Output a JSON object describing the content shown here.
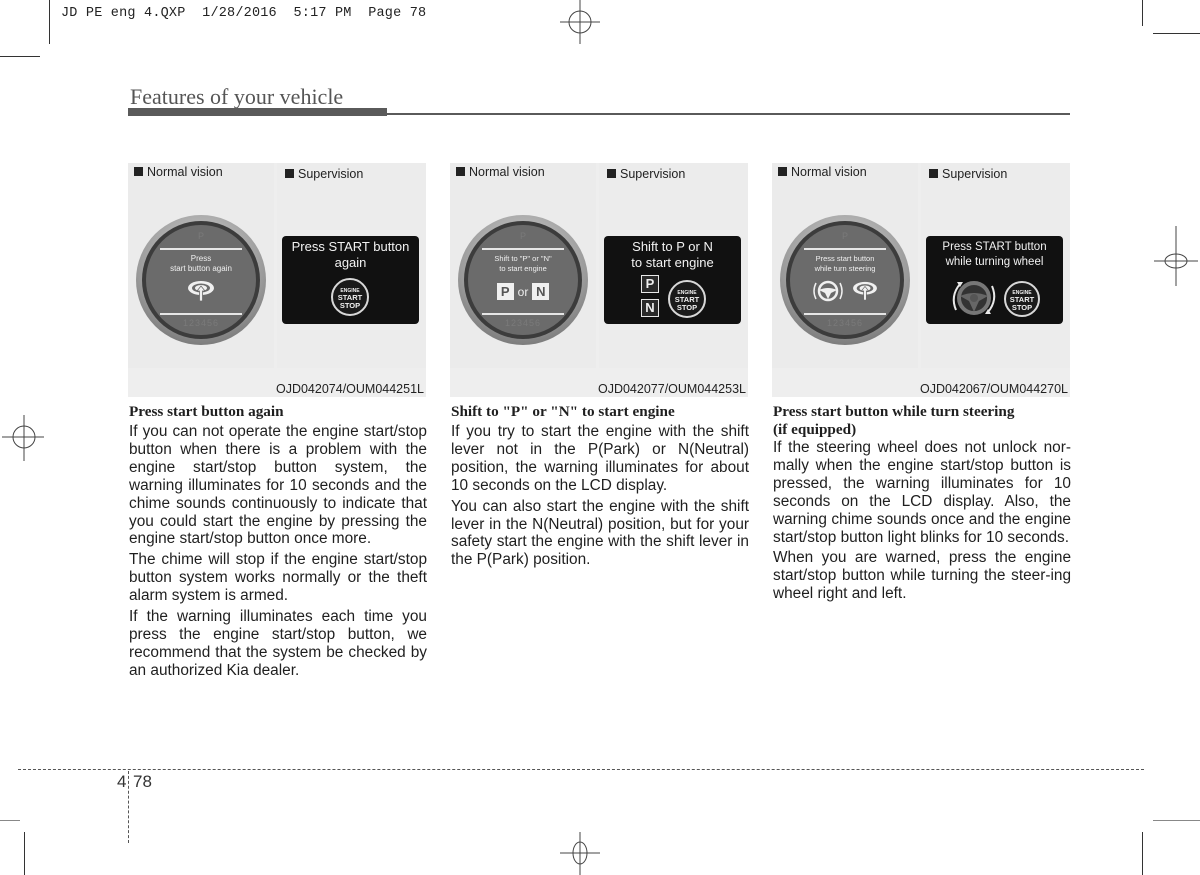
{
  "slug": {
    "file": "JD PE eng 4.QXP",
    "date": "1/28/2016",
    "time": "5:17 PM",
    "page_label": "Page 78"
  },
  "header": {
    "section_title": "Features of your vehicle"
  },
  "figures": [
    {
      "normal_label": "Normal vision",
      "supervision_label": "Supervision",
      "gauge_message_line1": "Press",
      "gauge_message_line2": "start button again",
      "gauge_icon": "start-button-press-icon",
      "lcd_line1": "Press START button",
      "lcd_line2": "again",
      "lcd_icon": "engine-start-stop-button-icon",
      "code": "OJD042074/OUM044251L"
    },
    {
      "normal_label": "Normal vision",
      "supervision_label": "Supervision",
      "gauge_message_line1": "Shift to \"P\" or \"N\"",
      "gauge_message_line2": "to start engine",
      "gauge_gear_p": "P",
      "gauge_gear_or": "or",
      "gauge_gear_n": "N",
      "lcd_line1": "Shift to P or N",
      "lcd_line2": "to start engine",
      "lcd_gear_p": "P",
      "lcd_gear_n": "N",
      "lcd_icon": "engine-start-stop-button-icon",
      "code": "OJD042077/OUM044253L"
    },
    {
      "normal_label": "Normal vision",
      "supervision_label": "Supervision",
      "gauge_message_line1": "Press start button",
      "gauge_message_line2": "while turn steering",
      "gauge_icons": [
        "steering-wheel-turn-icon",
        "start-button-press-icon"
      ],
      "lcd_line1": "Press START button",
      "lcd_line2": "while turning wheel",
      "lcd_icons": [
        "steering-wheel-rotate-icon",
        "engine-start-stop-button-icon"
      ],
      "code": "OJD042067/OUM044270L"
    }
  ],
  "engine_button": {
    "line1": "ENGINE",
    "line2": "START",
    "line3": "STOP"
  },
  "gauge_ghost": {
    "top": "P",
    "bottom": "123456"
  },
  "columns": [
    {
      "heading": "Press start button again",
      "paragraphs": [
        "If you can not operate the engine start/stop button when there is a problem with the engine start/stop button system, the warning illuminates for 10 seconds and the chime sounds continuously to indicate that you could start the engine by pressing the engine start/stop button once more.",
        "The chime will stop if the engine start/stop button system works normally or the theft alarm system is armed.",
        "If the warning illuminates each time you press the engine start/stop button, we recommend that the system be checked by an authorized Kia dealer."
      ]
    },
    {
      "heading": "Shift to \"P\" or \"N\" to start engine",
      "paragraphs": [
        "If you try to start the engine with the shift lever not in the P(Park) or N(Neutral) position, the warning illuminates for about 10 seconds on the LCD display.",
        "You can also start the engine with the shift lever in the N(Neutral) position, but for your safety start the engine with the shift lever in the P(Park) position."
      ]
    },
    {
      "heading_line1": "Press start button while turn steering",
      "heading_line2": "(if equipped)",
      "paragraphs": [
        "If the steering wheel does not unlock nor-mally when the engine start/stop button is pressed, the warning illuminates for 10 seconds on the LCD display. Also, the warning chime sounds once and the engine start/stop button light blinks for 10 seconds.",
        "When you are warned, press the engine start/stop button while turning the steer-ing wheel right and left."
      ]
    }
  ],
  "footer": {
    "chapter": "4",
    "page": "78"
  }
}
